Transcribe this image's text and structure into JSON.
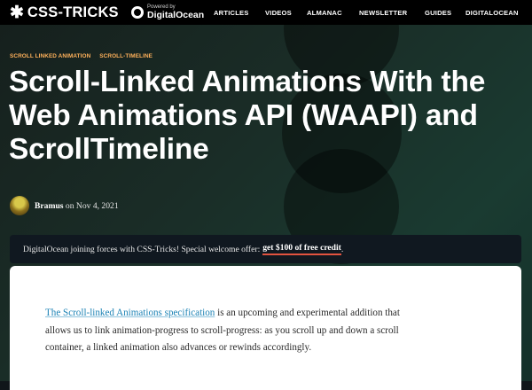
{
  "header": {
    "logo_star": "✱",
    "logo_text": "CSS-TRICKS",
    "powered_by": "Powered by",
    "powered_brand": "DigitalOcean",
    "nav": [
      "ARTICLES",
      "VIDEOS",
      "ALMANAC",
      "NEWSLETTER",
      "GUIDES",
      "DIGITALOCEAN"
    ]
  },
  "hero": {
    "tags": [
      "SCROLL LINKED ANIMATION",
      "SCROLL-TIMELINE"
    ],
    "title": "Scroll-Linked Animations With the Web Animations API (WAAPI) and ScrollTimeline",
    "author": "Bramus",
    "date_prefix": "on",
    "date": "Nov 4, 2021"
  },
  "promo": {
    "text": "DigitalOcean joining forces with CSS-Tricks! Special welcome offer:",
    "link": "get $100 of free credit",
    "end": "."
  },
  "article": {
    "link_text": "The Scroll-linked Animations specification",
    "body": "is an upcoming and experimental addition that allows us to link animation-progress to scroll-progress: as you scroll up and down a scroll container, a linked animation also advances or rewinds accordingly."
  },
  "colors": {
    "tag": "#ffb15a",
    "link": "#1b82b5",
    "promo_underline": "#e2533f",
    "topbar": "#000000"
  }
}
